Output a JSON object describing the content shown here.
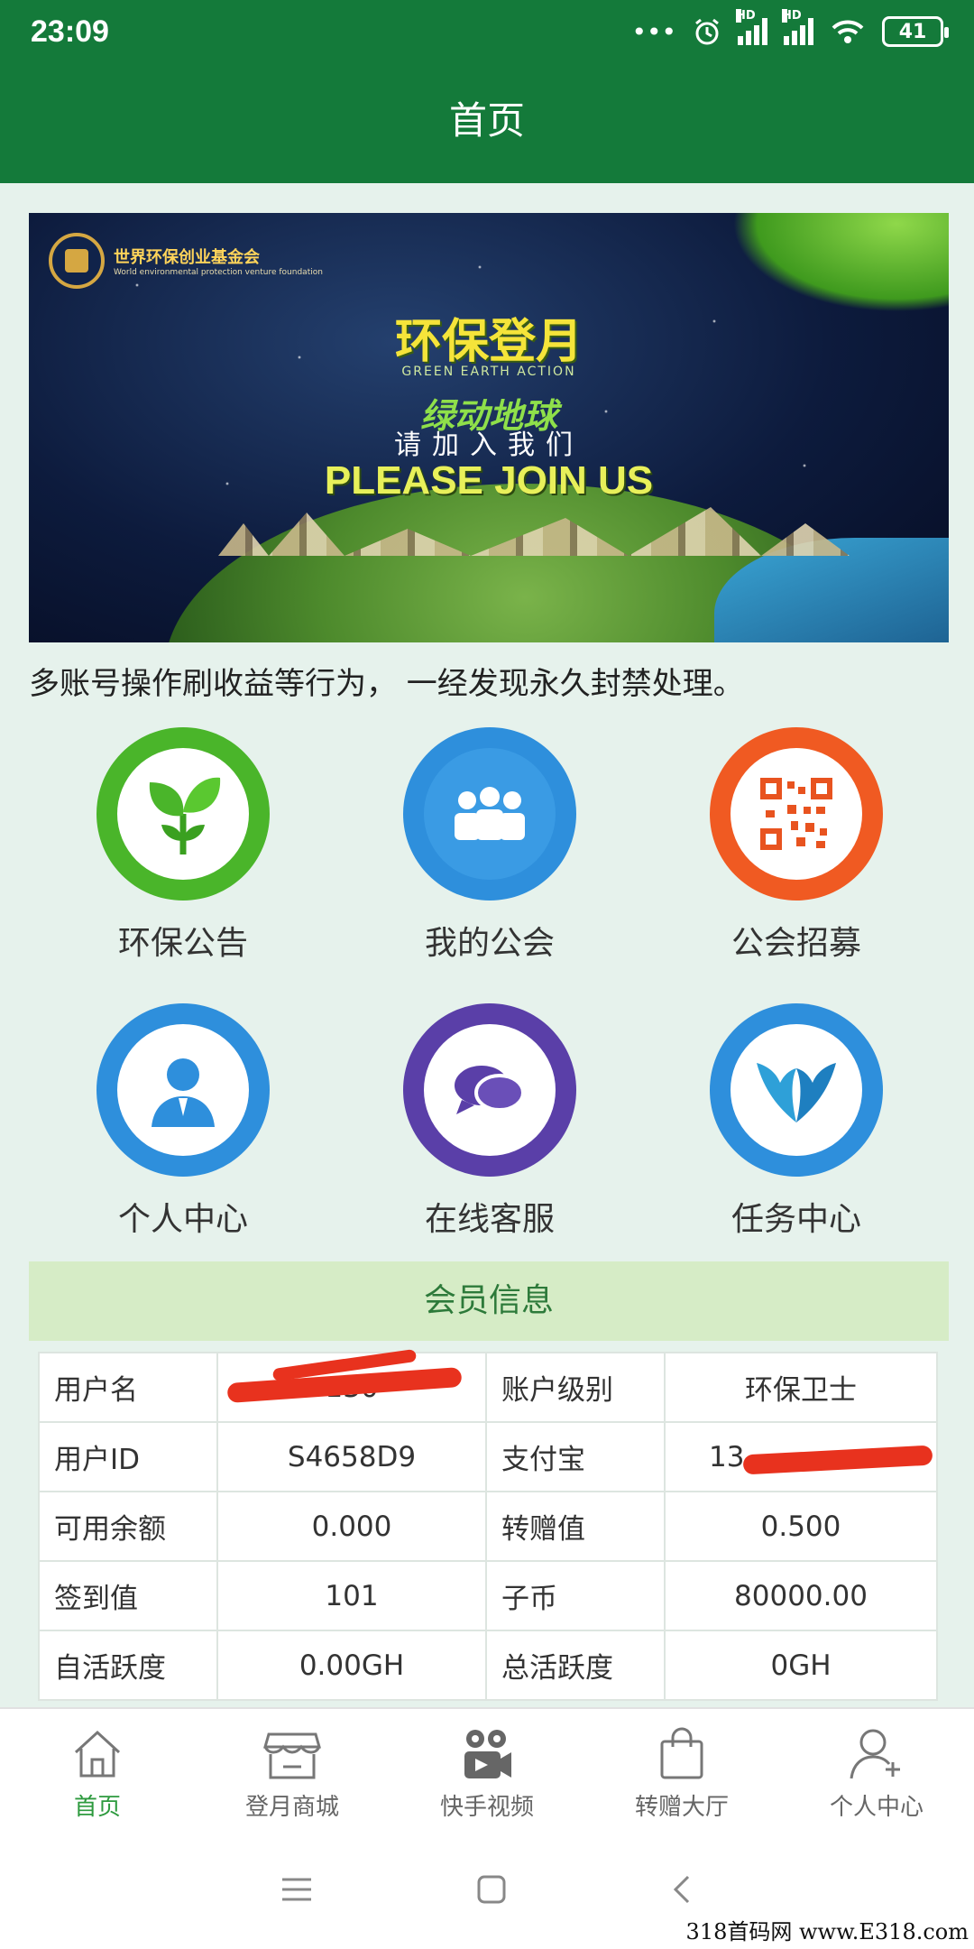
{
  "status": {
    "time": "23:09",
    "battery": "41",
    "hd1": "HD",
    "hd2": "HD"
  },
  "header": {
    "title": "首页"
  },
  "banner": {
    "org_name": "世界环保创业基金会",
    "org_subtitle": "World environmental protection venture foundation",
    "title": "环保登月",
    "tagline_en": "GREEN EARTH ACTION",
    "subtitle": "绿动地球",
    "invite_cn": "请加入我们",
    "invite_en": "PLEASE JOIN US"
  },
  "notice": "多账号操作刷收益等行为， 一经发现永久封禁处理。",
  "tiles": [
    {
      "label": "环保公告",
      "icon": "sprout-icon",
      "color": "#4ab52a"
    },
    {
      "label": "我的公会",
      "icon": "group-icon",
      "color": "#2e8fdc"
    },
    {
      "label": "公会招募",
      "icon": "qrcode-icon",
      "color": "#f05a22"
    },
    {
      "label": "个人中心",
      "icon": "person-icon",
      "color": "#2e8fdc"
    },
    {
      "label": "在线客服",
      "icon": "chat-icon",
      "color": "#5a3fa8"
    },
    {
      "label": "任务中心",
      "icon": "hands-icon",
      "color": "#2e8fdc"
    }
  ],
  "member": {
    "title": "会员信息",
    "rows": [
      {
        "k1": "用户名",
        "v1": "130",
        "k2": "账户级别",
        "v2": "环保卫士"
      },
      {
        "k1": "用户ID",
        "v1": "S4658D9",
        "k2": "支付宝",
        "v2": "13"
      },
      {
        "k1": "可用余额",
        "v1": "0.000",
        "k2": "转赠值",
        "v2": "0.500"
      },
      {
        "k1": "签到值",
        "v1": "101",
        "k2": "子币",
        "v2": "80000.00"
      },
      {
        "k1": "自活跃度",
        "v1": "0.00GH",
        "k2": "总活跃度",
        "v2": "0GH"
      }
    ]
  },
  "tabbar": [
    {
      "label": "首页",
      "icon": "home-icon",
      "active": true
    },
    {
      "label": "登月商城",
      "icon": "store-icon",
      "active": false
    },
    {
      "label": "快手视频",
      "icon": "video-camera-icon",
      "active": false
    },
    {
      "label": "转赠大厅",
      "icon": "shopping-bag-icon",
      "active": false
    },
    {
      "label": "个人中心",
      "icon": "user-add-icon",
      "active": false
    }
  ],
  "watermark": "318首码网  www.E318.com",
  "colors": {
    "header": "#147a3a",
    "active": "#2d9a3e",
    "redaction": "#e8321e"
  }
}
